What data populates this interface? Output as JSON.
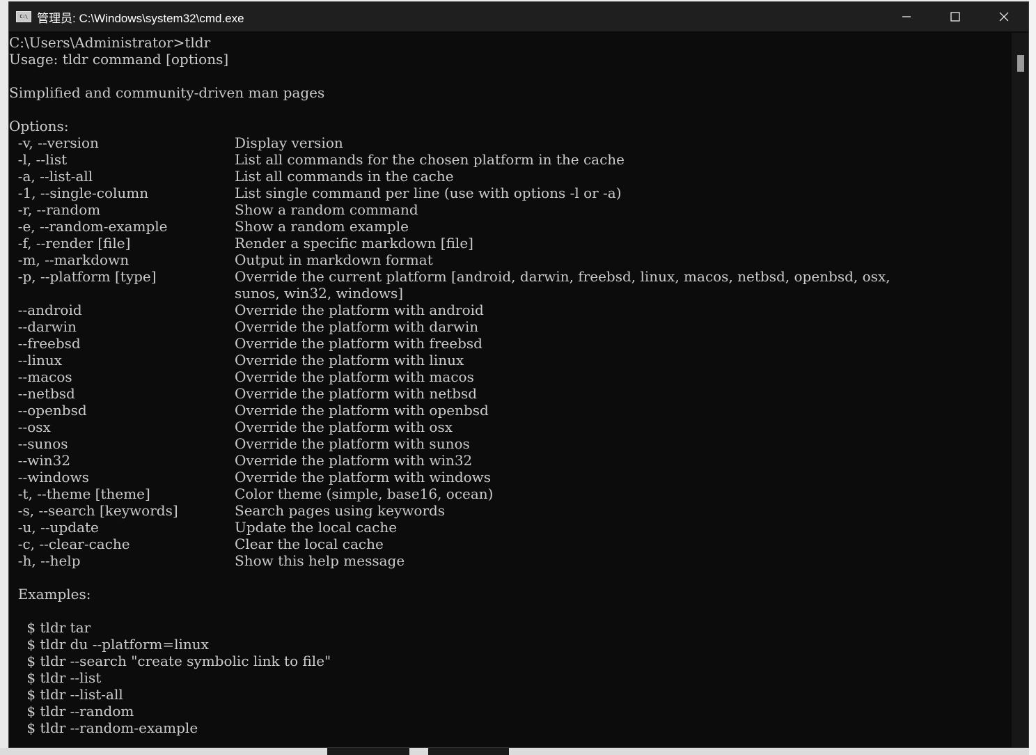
{
  "window": {
    "title": "管理员:  C:\\Windows\\system32\\cmd.exe",
    "icon": "console-icon",
    "icon_text": "C:\\"
  },
  "controls": {
    "minimize": "minimize-icon",
    "maximize": "maximize-icon",
    "close": "close-icon"
  },
  "terminal": {
    "prompt_line": "C:\\Users\\Administrator>tldr",
    "usage": "Usage: tldr command [options]",
    "description": "Simplified and community-driven man pages",
    "options_header": "Options:",
    "options": [
      {
        "opt": "  -v, --version",
        "desc": "Display version"
      },
      {
        "opt": "  -l, --list",
        "desc": "List all commands for the chosen platform in the cache"
      },
      {
        "opt": "  -a, --list-all",
        "desc": "List all commands in the cache"
      },
      {
        "opt": "  -1, --single-column",
        "desc": "List single command per line (use with options -l or -a)"
      },
      {
        "opt": "  -r, --random",
        "desc": "Show a random command"
      },
      {
        "opt": "  -e, --random-example",
        "desc": "Show a random example"
      },
      {
        "opt": "  -f, --render [file]",
        "desc": "Render a specific markdown [file]"
      },
      {
        "opt": "  -m, --markdown",
        "desc": "Output in markdown format"
      },
      {
        "opt": "  -p, --platform [type]",
        "desc": "Override the current platform [android, darwin, freebsd, linux, macos, netbsd, openbsd, osx,"
      },
      {
        "opt": "",
        "desc": "sunos, win32, windows]"
      },
      {
        "opt": "  --android",
        "desc": "Override the platform with android"
      },
      {
        "opt": "  --darwin",
        "desc": "Override the platform with darwin"
      },
      {
        "opt": "  --freebsd",
        "desc": "Override the platform with freebsd"
      },
      {
        "opt": "  --linux",
        "desc": "Override the platform with linux"
      },
      {
        "opt": "  --macos",
        "desc": "Override the platform with macos"
      },
      {
        "opt": "  --netbsd",
        "desc": "Override the platform with netbsd"
      },
      {
        "opt": "  --openbsd",
        "desc": "Override the platform with openbsd"
      },
      {
        "opt": "  --osx",
        "desc": "Override the platform with osx"
      },
      {
        "opt": "  --sunos",
        "desc": "Override the platform with sunos"
      },
      {
        "opt": "  --win32",
        "desc": "Override the platform with win32"
      },
      {
        "opt": "  --windows",
        "desc": "Override the platform with windows"
      },
      {
        "opt": "  -t, --theme [theme]",
        "desc": "Color theme (simple, base16, ocean)"
      },
      {
        "opt": "  -s, --search [keywords]",
        "desc": "Search pages using keywords"
      },
      {
        "opt": "  -u, --update",
        "desc": "Update the local cache"
      },
      {
        "opt": "  -c, --clear-cache",
        "desc": "Clear the local cache"
      },
      {
        "opt": "  -h, --help",
        "desc": "Show this help message"
      }
    ],
    "examples_header": "  Examples:",
    "examples": [
      "    $ tldr tar",
      "    $ tldr du --platform=linux",
      "    $ tldr --search \"create symbolic link to file\"",
      "    $ tldr --list",
      "    $ tldr --list-all",
      "    $ tldr --random",
      "    $ tldr --random-example"
    ]
  },
  "colors": {
    "terminal_bg": "#0c0c0c",
    "terminal_fg": "#cccccc",
    "titlebar_bg": "#1f1f1f"
  }
}
